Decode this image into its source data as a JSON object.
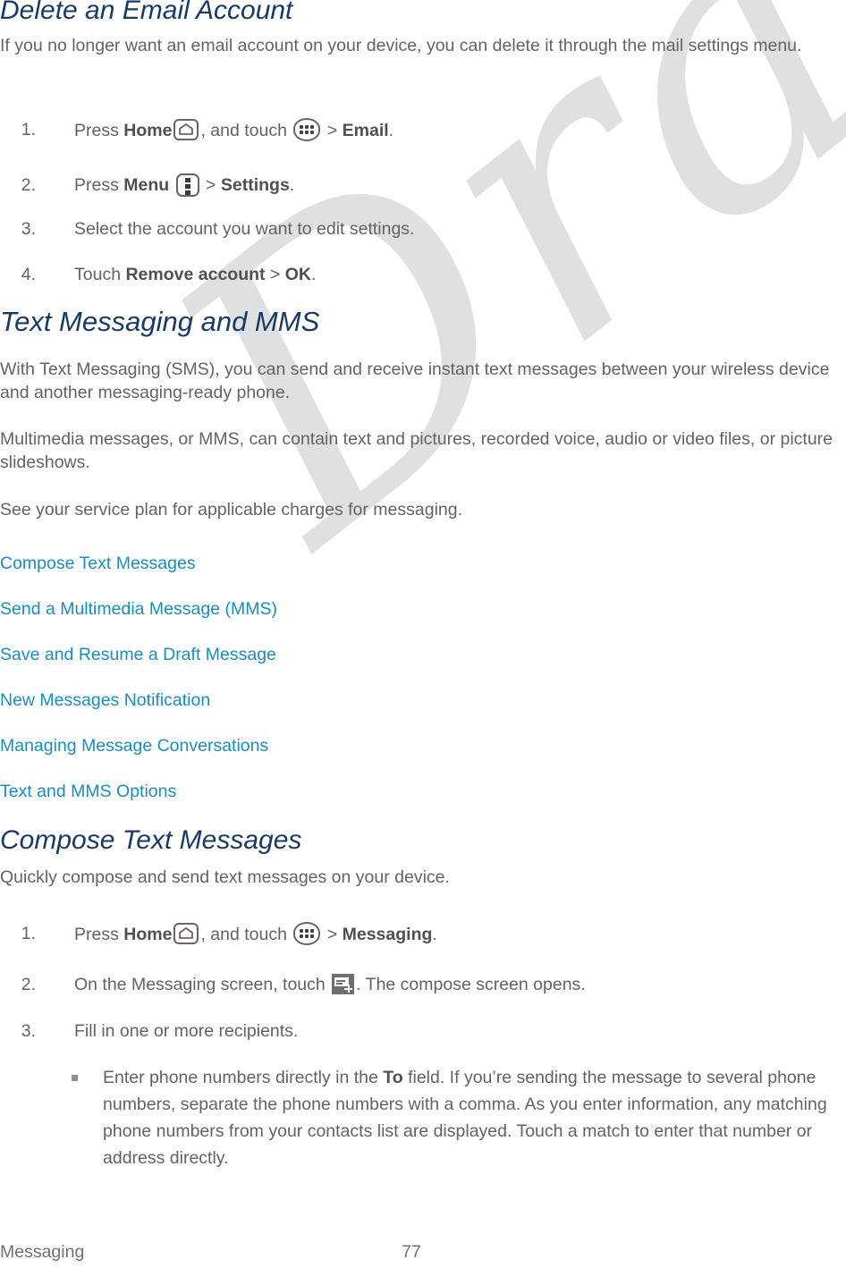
{
  "document": {
    "watermark": "Draft",
    "colors": {
      "heading": "#1a3a66",
      "body": "#616365",
      "link": "#1b8cbe",
      "watermark": "#dfe0e1",
      "icon_outline": "#6e6260",
      "compose_icon_fill": "#6d6f71"
    }
  },
  "section_delete_email": {
    "heading": "Delete an Email Account",
    "intro": "If you no longer want an email account on your device, you can delete it through the mail settings menu.",
    "steps": [
      {
        "number": "1.",
        "pre": "Press",
        "bold1": "Home",
        "icon1": "home-icon",
        "mid": ", and touch",
        "icon2": "apps-drawer-icon",
        "gt": ">",
        "bold2": "Email",
        "post": "."
      },
      {
        "number": "2.",
        "pre": "Press",
        "bold1": "Menu",
        "icon1": "menu-icon",
        "gt": ">",
        "bold2": "Settings",
        "post": "."
      },
      {
        "number": "3.",
        "text": "Select the account you want to edit settings."
      },
      {
        "number": "4.",
        "pre": "Touch",
        "bold1": "Remove account",
        "gt": ">",
        "bold2": "OK",
        "post": "."
      }
    ]
  },
  "section_text_messaging": {
    "heading": "Text Messaging and MMS",
    "paragraphs": [
      "With Text Messaging (SMS), you can send and receive instant text messages between your wireless device and another messaging-ready phone.",
      "Multimedia messages, or MMS, can contain text and pictures, recorded voice, audio or video files, or picture slideshows.",
      "See your service plan for applicable charges for messaging."
    ],
    "links": [
      "Compose Text Messages",
      "Send a Multimedia Message (MMS)",
      "Save and Resume a Draft Message",
      "New Messages Notification",
      "Managing Message Conversations",
      "Text and MMS Options"
    ]
  },
  "section_compose": {
    "heading": "Compose Text Messages",
    "intro": "Quickly compose and send text messages on your device.",
    "steps": [
      {
        "number": "1.",
        "pre": "Press",
        "bold1": "Home",
        "icon1": "home-icon",
        "mid": ", and touch",
        "icon2": "apps-drawer-icon",
        "gt": ">",
        "bold2": "Messaging",
        "post": "."
      },
      {
        "number": "2.",
        "pre": "On the Messaging screen, touch",
        "icon1": "compose-message-icon",
        "post": ". The compose screen opens."
      },
      {
        "number": "3.",
        "text": "Fill in one or more recipients."
      }
    ],
    "bullets": [
      {
        "pre": "Enter phone numbers directly in the",
        "bold": "To",
        "post": "field. If you’re sending the message to several phone numbers, separate the phone numbers with a comma. As you enter information, any matching phone numbers from your contacts list are displayed. Touch a match to enter that number or address directly."
      }
    ]
  },
  "footer": {
    "left": "Messaging",
    "page_number": "77"
  }
}
